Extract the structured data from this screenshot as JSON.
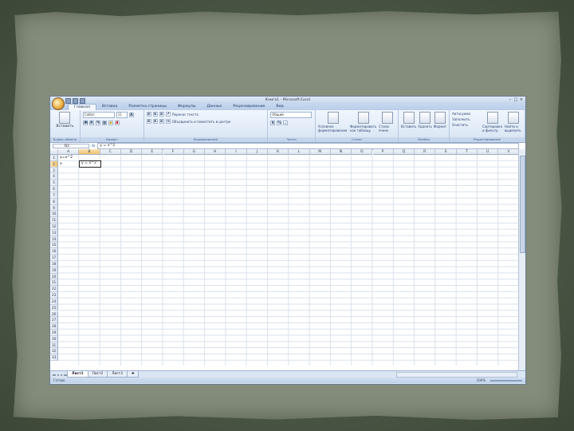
{
  "window": {
    "title": "Книга1 - Microsoft Excel",
    "window_buttons": [
      "–",
      "□",
      "×"
    ]
  },
  "ribbon": {
    "tabs": [
      "Главная",
      "Вставка",
      "Разметка страницы",
      "Формулы",
      "Данные",
      "Рецензирование",
      "Вид"
    ],
    "clipboard": {
      "paste_label": "Вставить",
      "group_label": "Буфер обмена"
    },
    "font": {
      "name": "Calibri",
      "size": "11",
      "group_label": "Шрифт",
      "bold": "Ж",
      "italic": "К",
      "underline": "Ч"
    },
    "alignment": {
      "wrap_label": "Перенос текста",
      "merge_label": "Объединить и поместить в центре",
      "group_label": "Выравнивание"
    },
    "number": {
      "format": "Общий",
      "group_label": "Число"
    },
    "styles": {
      "cond_format": "Условное форматирование",
      "format_table": "Форматировать как таблицу",
      "cell_styles": "Стили ячеек",
      "group_label": "Стили"
    },
    "cells": {
      "insert": "Вставить",
      "delete": "Удалить",
      "format": "Формат",
      "group_label": "Ячейки"
    },
    "editing": {
      "autosum": "Автосумма",
      "fill": "Заполнить",
      "clear": "Очистить",
      "sort": "Сортировка и фильтр",
      "find": "Найти и выделить",
      "group_label": "Редактирование"
    }
  },
  "formula_bar": {
    "cell_ref": "B2",
    "fx": "fx",
    "content": "y = x^2"
  },
  "columns": [
    "A",
    "B",
    "C",
    "D",
    "E",
    "F",
    "G",
    "H",
    "I",
    "J",
    "K",
    "L",
    "M",
    "N",
    "O",
    "P",
    "Q",
    "R",
    "S",
    "T",
    "U",
    "V"
  ],
  "rows": [
    "1",
    "2",
    "3",
    "4",
    "5",
    "6",
    "7",
    "8",
    "9",
    "10",
    "11",
    "12",
    "13",
    "14",
    "15",
    "16",
    "17",
    "18",
    "19",
    "20",
    "21",
    "22",
    "23",
    "24",
    "25",
    "26",
    "27",
    "28",
    "29",
    "30",
    "31",
    "32",
    "33"
  ],
  "cells": {
    "a1": "y=x^2",
    "a2": "x",
    "b2": "y = x^2"
  },
  "sheets": {
    "tabs": [
      "Лист1",
      "Лист2",
      "Лист3"
    ],
    "nav": [
      "◂◂",
      "◂",
      "▸",
      "▸▸"
    ]
  },
  "status": {
    "ready": "Готово",
    "zoom": "100%"
  }
}
